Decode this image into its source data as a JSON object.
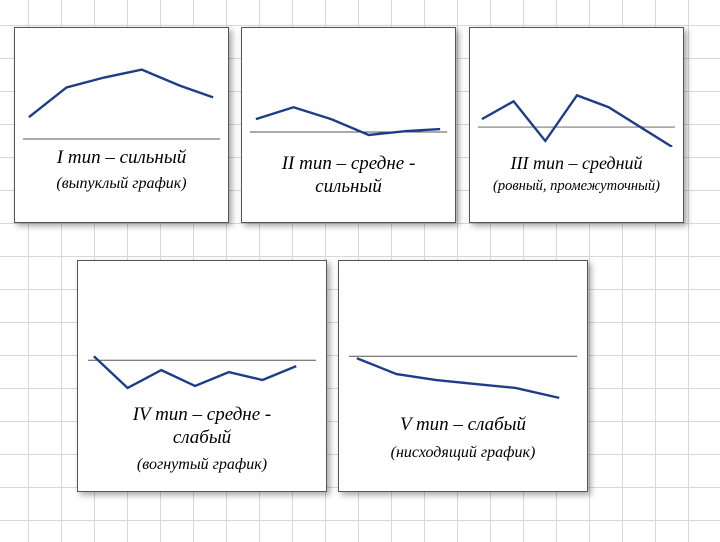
{
  "chart_data": [
    {
      "type": "line",
      "title": "I тип – сильный",
      "subtitle": "(выпуклый график)",
      "xlabel": "",
      "ylabel": "",
      "x": [
        0,
        1,
        2,
        3,
        4,
        5
      ],
      "values": [
        18,
        34,
        42,
        50,
        40,
        32
      ],
      "ylim": [
        0,
        60
      ]
    },
    {
      "type": "line",
      "title": "II тип – средне - сильный",
      "subtitle": "",
      "xlabel": "",
      "ylabel": "",
      "x": [
        0,
        1,
        2,
        3,
        4,
        5
      ],
      "values": [
        10,
        18,
        10,
        0,
        2,
        4
      ],
      "ylim": [
        -30,
        30
      ]
    },
    {
      "type": "line",
      "title": "III тип – средний",
      "subtitle": "(ровный, промежуточный)",
      "xlabel": "",
      "ylabel": "",
      "x": [
        0,
        1,
        2,
        3,
        4,
        5,
        6
      ],
      "values": [
        8,
        22,
        -12,
        28,
        18,
        2,
        -18
      ],
      "ylim": [
        -30,
        30
      ]
    },
    {
      "type": "line",
      "title": "IV тип – средне - слабый",
      "subtitle": "(вогнутый график)",
      "xlabel": "",
      "ylabel": "",
      "x": [
        0,
        1,
        2,
        3,
        4,
        5,
        6
      ],
      "values": [
        4,
        -20,
        -6,
        -18,
        -8,
        -14,
        -4
      ],
      "ylim": [
        -30,
        10
      ]
    },
    {
      "type": "line",
      "title": "V тип – слабый",
      "subtitle": "(нисходящий график)",
      "xlabel": "",
      "ylabel": "",
      "x": [
        0,
        1,
        2,
        3,
        4,
        5
      ],
      "values": [
        -2,
        -16,
        -22,
        -26,
        -30,
        -38
      ],
      "ylim": [
        -45,
        5
      ]
    }
  ]
}
